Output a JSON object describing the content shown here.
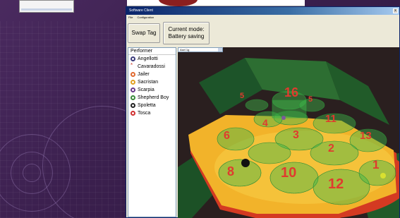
{
  "window": {
    "title": "Software Client",
    "menu": [
      "File",
      "Configuration"
    ],
    "close_glyph": "x"
  },
  "toolbar": {
    "swap_label": "Swap Tag",
    "mode_line1": "Current mode:",
    "mode_line2": "Battery saving"
  },
  "performer_panel": {
    "header": "Performer",
    "items": [
      {
        "label": "Angellotti",
        "color": "#3a3a7a",
        "icon": "circle-icon"
      },
      {
        "label": "Cavaradossi",
        "color": "#d04030",
        "icon": "star-icon"
      },
      {
        "label": "Jailer",
        "color": "#e06a30",
        "icon": "circle-icon"
      },
      {
        "label": "Sacristan",
        "color": "#e0a020",
        "icon": "circle-icon"
      },
      {
        "label": "Scarpia",
        "color": "#6a3a8a",
        "icon": "circle-icon"
      },
      {
        "label": "Shepherd Boy",
        "color": "#3a8a3a",
        "icon": "circle-icon"
      },
      {
        "label": "Spoletta",
        "color": "#222222",
        "icon": "circle-icon"
      },
      {
        "label": "Tosca",
        "color": "#d03030",
        "icon": "circle-icon"
      }
    ]
  },
  "view": {
    "selector_value": "Asel 1g",
    "zones": [
      "1",
      "2",
      "3",
      "4",
      "5",
      "6",
      "8",
      "10",
      "11",
      "12",
      "13",
      "16"
    ]
  }
}
